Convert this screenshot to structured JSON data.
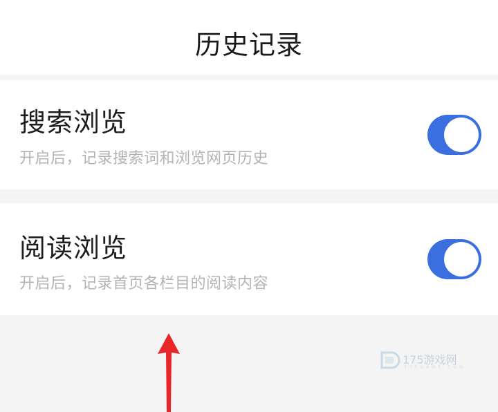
{
  "header": {
    "title": "历史记录"
  },
  "settings": [
    {
      "title": "搜索浏览",
      "description": "开启后，记录搜索词和浏览网页历史",
      "enabled": true
    },
    {
      "title": "阅读浏览",
      "description": "开启后，记录首页各栏目的阅读内容",
      "enabled": true
    }
  ],
  "watermark": {
    "text": "175游戏网",
    "sub": "175GAME.COM"
  },
  "colors": {
    "toggle_on": "#3b6fe0",
    "annotation_arrow": "#e8262a",
    "page_background": "#f4f4f5"
  }
}
